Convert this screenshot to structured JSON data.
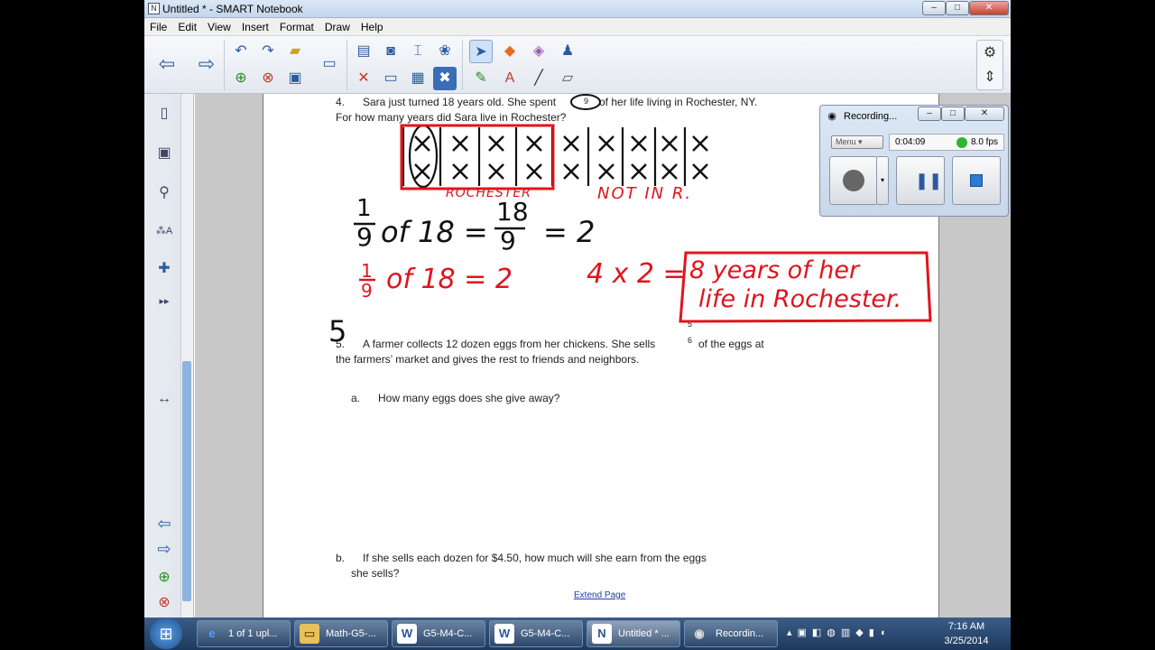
{
  "window": {
    "title": "Untitled * - SMART Notebook",
    "app_icon": "notebook-icon"
  },
  "menu": [
    "File",
    "Edit",
    "View",
    "Insert",
    "Format",
    "Draw",
    "Help"
  ],
  "page": {
    "q4_number": "4.",
    "q4_line1_a": "Sara just turned 18 years old.  She spent",
    "q4_fraction_circled": "9",
    "q4_line1_b": "of her life living in Rochester, NY.",
    "q4_line2": "For how many years did Sara live in Rochester?",
    "q5_number": "5.",
    "q5_line1_a": "A farmer collects 12 dozen eggs from her chickens.  She sells",
    "q5_fraction_num": "5",
    "q5_fraction_den": "6",
    "q5_line1_b": "of the eggs at",
    "q5_line2": "the farmers’ market and gives the rest to friends and neighbors.",
    "q5a_label": "a.",
    "q5a_text": "How many eggs does she give away?",
    "q5b_label": "b.",
    "q5b_text_1": "If she sells each dozen for $4.50, how much will she earn from the eggs",
    "q5b_text_2": "she sells?",
    "extend_link": "Extend Page"
  },
  "ink": {
    "tape_label_red": "ROCHESTER",
    "tape_label_not": "NOT IN R.",
    "black_eq_frac_top": "1",
    "black_eq_frac_bot": "9",
    "black_eq_of": "of 18 =",
    "black_eq_num": "18",
    "black_eq_den": "9",
    "black_eq_result": "= 2",
    "red_eq": "of 18 = 2",
    "red_frac_top": "1",
    "red_frac_bot": "9",
    "red_mult": "4 x 2 =",
    "red_answer_1": "8 years of her",
    "red_answer_2": "life in Rochester.",
    "big_five": "5"
  },
  "recording": {
    "title": "Recording...",
    "menu_label": "Menu",
    "elapsed": "0:04:09",
    "fps": "8.0 fps",
    "status_color": "#2db52d"
  },
  "taskbar": {
    "start_icon": "windows-start-icon",
    "items": [
      {
        "label": "1 of 1 upl...",
        "icon": "ie-icon"
      },
      {
        "label": "Math-G5-...",
        "icon": "folder-icon"
      },
      {
        "label": "G5-M4-C...",
        "icon": "word-icon"
      },
      {
        "label": "G5-M4-C...",
        "icon": "word-icon"
      },
      {
        "label": "Untitled * ...",
        "icon": "notebook-icon"
      },
      {
        "label": "Recordin...",
        "icon": "recorder-icon"
      }
    ],
    "time": "7:16 AM",
    "date": "3/25/2014"
  },
  "colors": {
    "ink_red": "#e0141e",
    "ink_black": "#111111",
    "accent": "#2c5aa0"
  }
}
